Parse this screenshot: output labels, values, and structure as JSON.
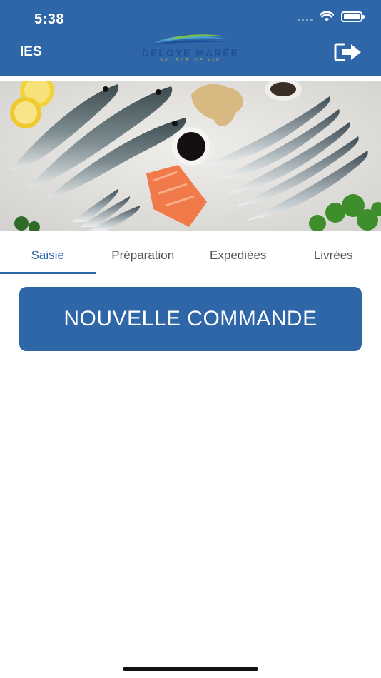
{
  "status_bar": {
    "time": "5:38"
  },
  "header": {
    "user_code": "IES",
    "logo_name": "DELOYE MARÉE",
    "logo_tagline": "SOURCE DE VIE",
    "colors": {
      "bar": "#2f66a8"
    }
  },
  "tabs": [
    {
      "label": "Saisie",
      "active": true
    },
    {
      "label": "Préparation",
      "active": false
    },
    {
      "label": "Expediées",
      "active": false
    },
    {
      "label": "Livrées",
      "active": false
    }
  ],
  "main": {
    "new_order_label": "NOUVELLE COMMANDE"
  }
}
